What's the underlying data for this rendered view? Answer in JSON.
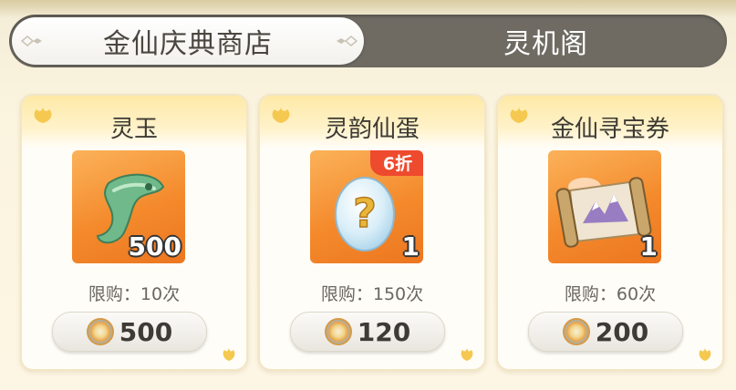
{
  "tabs": [
    {
      "label": "金仙庆典商店",
      "active": true
    },
    {
      "label": "灵机阁",
      "active": false
    }
  ],
  "items": [
    {
      "name": "灵玉",
      "quantity": "500",
      "limit": "限购：10次",
      "price": "500",
      "discount": "",
      "icon": "jade-icon"
    },
    {
      "name": "灵韵仙蛋",
      "quantity": "1",
      "limit": "限购：150次",
      "price": "120",
      "discount": "6折",
      "icon": "mystery-egg-icon"
    },
    {
      "name": "金仙寻宝券",
      "quantity": "1",
      "limit": "限购：60次",
      "price": "200",
      "discount": "",
      "icon": "treasure-map-scroll-icon"
    }
  ],
  "currency_icon": "spirit-coin-icon",
  "colors": {
    "item_bg": "#f48a2c",
    "discount_badge": "#ee4a2e",
    "tab_bar": "#6f6b63"
  }
}
